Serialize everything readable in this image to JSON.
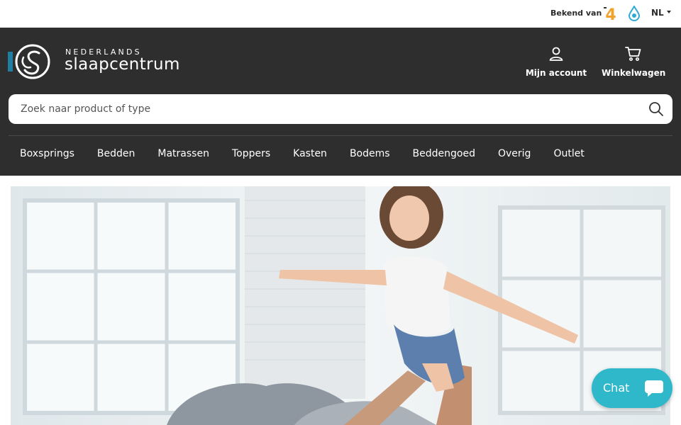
{
  "topbar": {
    "known_from_label": "Bekend van",
    "tv_logo_text": "4",
    "language": "NL",
    "icons": [
      "tv-channel-logo",
      "water-drop-logo",
      "chevron-down-icon"
    ]
  },
  "header": {
    "logo": {
      "small_text": "NEDERLANDS",
      "big_text": "slaapcentrum"
    },
    "account_label": "Mijn account",
    "cart_label": "Winkelwagen",
    "icons": [
      "user-icon",
      "cart-icon"
    ]
  },
  "search": {
    "placeholder": "Zoek naar product of type",
    "value": "",
    "icon": "search-icon"
  },
  "nav": {
    "items": [
      "Boxsprings",
      "Bedden",
      "Matrassen",
      "Toppers",
      "Kasten",
      "Bodems",
      "Beddengoed",
      "Overig",
      "Outlet"
    ]
  },
  "hero": {
    "image_description_icon": "hero-photo"
  },
  "chat": {
    "label": "Chat",
    "icon": "chat-bubble-icon"
  },
  "colors": {
    "header_bg": "#2e2e2e",
    "topbar_bg": "#ffffff",
    "accent": "#2fb8c9",
    "text_light": "#ffffff",
    "logo_blue": "#1f7fa0"
  }
}
